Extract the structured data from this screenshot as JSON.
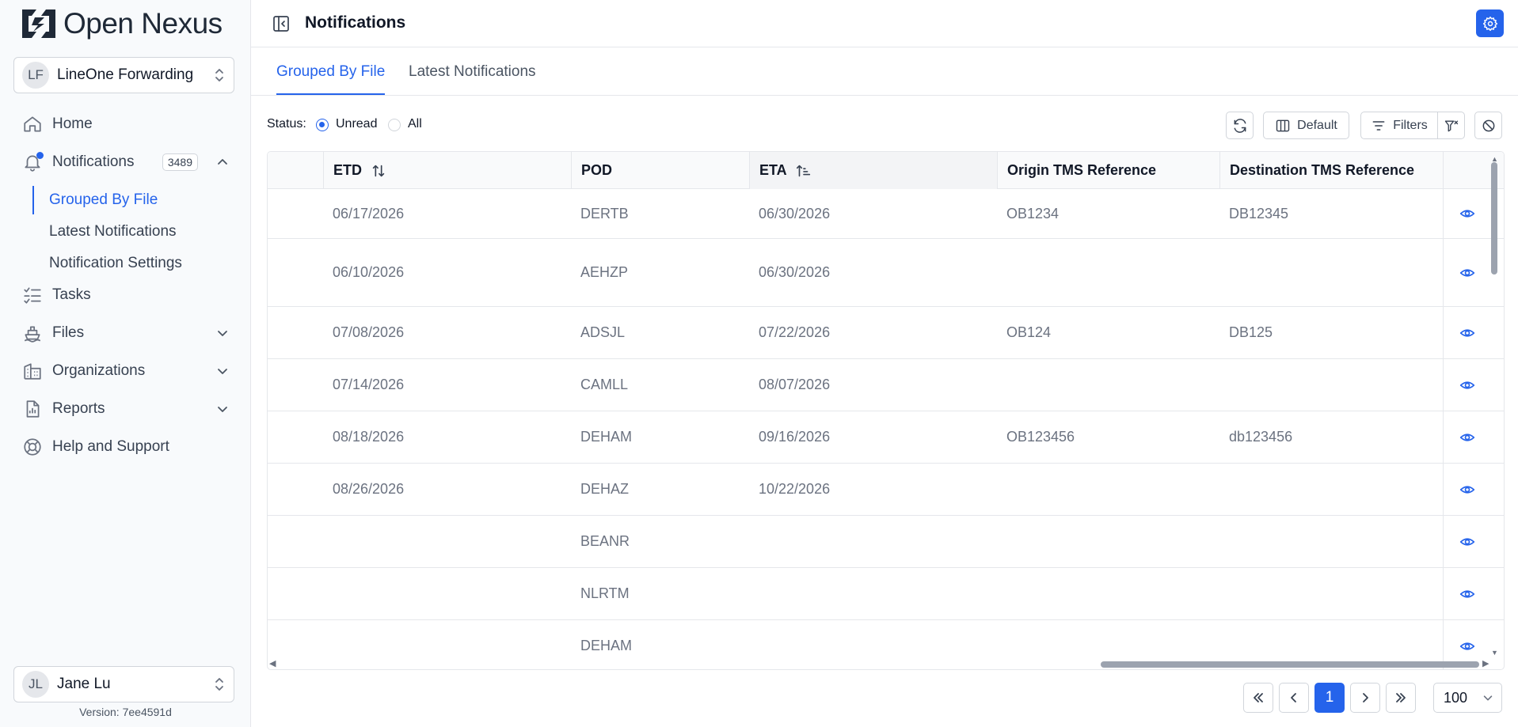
{
  "app": {
    "logo_open": "Open",
    "logo_nexus": "Nexus"
  },
  "org": {
    "initials": "LF",
    "name": "LineOne Forwarding"
  },
  "sidebar": {
    "items": [
      {
        "label": "Home",
        "icon": "home-icon"
      },
      {
        "label": "Notifications",
        "icon": "bell-icon",
        "badge": "3489"
      },
      {
        "label": "Tasks",
        "icon": "tasks-icon"
      },
      {
        "label": "Files",
        "icon": "ship-icon"
      },
      {
        "label": "Organizations",
        "icon": "building-icon"
      },
      {
        "label": "Reports",
        "icon": "report-icon"
      },
      {
        "label": "Help and Support",
        "icon": "lifebuoy-icon"
      }
    ],
    "sub_items": [
      {
        "label": "Grouped By File"
      },
      {
        "label": "Latest Notifications"
      },
      {
        "label": "Notification Settings"
      }
    ]
  },
  "user": {
    "initials": "JL",
    "name": "Jane Lu"
  },
  "version": "Version: 7ee4591d",
  "header": {
    "title": "Notifications"
  },
  "tabs": [
    {
      "label": "Grouped By File"
    },
    {
      "label": "Latest Notifications"
    }
  ],
  "toolbar": {
    "status_label": "Status:",
    "radio_unread": "Unread",
    "radio_all": "All",
    "default_label": "Default",
    "filters_label": "Filters"
  },
  "table": {
    "columns": [
      "ETD",
      "POD",
      "ETA",
      "Origin TMS Reference",
      "Destination TMS Reference"
    ],
    "rows": [
      {
        "etd": "06/17/2026",
        "pod": "DERTB",
        "eta": "06/30/2026",
        "origin": "OB1234",
        "dest": "DB12345"
      },
      {
        "etd": "06/10/2026",
        "pod": "AEHZP",
        "eta": "06/30/2026",
        "origin": "",
        "dest": ""
      },
      {
        "etd": "07/08/2026",
        "pod": "ADSJL",
        "eta": "07/22/2026",
        "origin": "OB124",
        "dest": "DB125"
      },
      {
        "etd": "07/14/2026",
        "pod": "CAMLL",
        "eta": "08/07/2026",
        "origin": "",
        "dest": ""
      },
      {
        "etd": "08/18/2026",
        "pod": "DEHAM",
        "eta": "09/16/2026",
        "origin": "OB123456",
        "dest": "db123456"
      },
      {
        "etd": "08/26/2026",
        "pod": "DEHAZ",
        "eta": "10/22/2026",
        "origin": "",
        "dest": ""
      },
      {
        "etd": "",
        "pod": "BEANR",
        "eta": "",
        "origin": "",
        "dest": ""
      },
      {
        "etd": "",
        "pod": "NLRTM",
        "eta": "",
        "origin": "",
        "dest": ""
      },
      {
        "etd": "",
        "pod": "DEHAM",
        "eta": "",
        "origin": "",
        "dest": ""
      }
    ]
  },
  "pagination": {
    "current_page": "1",
    "page_size": "100"
  },
  "colors": {
    "accent": "#2563eb",
    "border": "#d1d5db",
    "muted_text": "#6b7280"
  }
}
